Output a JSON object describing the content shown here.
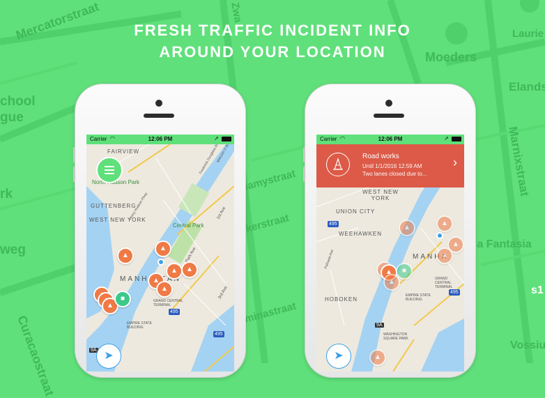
{
  "headline": {
    "line1": "FRESH TRAFFIC INCIDENT INFO",
    "line2": "AROUND YOUR LOCATION"
  },
  "background_labels": {
    "mercatorstraat": "Mercatorstraat",
    "school": "chool",
    "gue": "gue",
    "rk": "rk",
    "weg": "weg",
    "curacaostraat": "Curacaostraat",
    "moeders": "Moeders",
    "laurierstraat": "Laurie",
    "elandsstraat": "Elands",
    "marnixstraat": "Marnixstraat",
    "fantasia": "ia Fantasia",
    "vossius": "Vossiu",
    "s1": "s1",
    "lamystraat": "lamystraat",
    "kerstraat": "kerstraat",
    "minastraat": "minastraat",
    "zwa": "Zwa"
  },
  "phones": [
    {
      "status": {
        "carrier": "Carrier",
        "time": "12:06 PM"
      },
      "menu_label": "Menu",
      "map_labels": {
        "fairview": "FAIRVIEW",
        "north_hudson_park": "North Hudson Park",
        "guttenberg": "GUTTENBERG",
        "west_new_york": "WEST NEW YORK",
        "central_park": "Central Park",
        "manhattan": "MANHATTAN",
        "grand_central": "GRAND CENTRAL TERMINAL",
        "empire_state": "EMPIRE STATE BUILDING",
        "park_ave": "Park Ave",
        "frederick_douglass": "Frederick Douglass Blvd",
        "malcolm_x": "Malcolm X Blvd",
        "first_ave": "1st Ave",
        "third_ave": "3rd Ave",
        "henry_hudson": "Henry Hudson Pkwy",
        "shield_495": "495",
        "shield_495b": "495",
        "badge_9a": "9A"
      }
    },
    {
      "status": {
        "carrier": "Carrier",
        "time": "12:06 PM"
      },
      "incident": {
        "title": "Road works",
        "until": "Until 1/1/2016 12:59 AM",
        "description": "Two lanes closed due to..."
      },
      "map_labels": {
        "union_city": "UNION CITY",
        "west_new_york": "WEST NEW YORK",
        "weehawken": "WEEHAWKEN",
        "hoboken": "HOBOKEN",
        "manhattan": "MANHA",
        "grand_central": "GRAND CENTRAL TERMINAL",
        "empire_state": "EMPIRE STATE BUILDING",
        "washington_square": "WASHINGTON SQUARE PARK",
        "palisade": "Palisade Ave",
        "shield_495": "495",
        "shield_495b": "495",
        "badge_9a": "9A"
      }
    }
  ],
  "colors": {
    "brand_green": "#5fe07a",
    "incident_orange": "#f07a45",
    "banner_red": "#dc5a47",
    "water": "#a4d2f2"
  }
}
